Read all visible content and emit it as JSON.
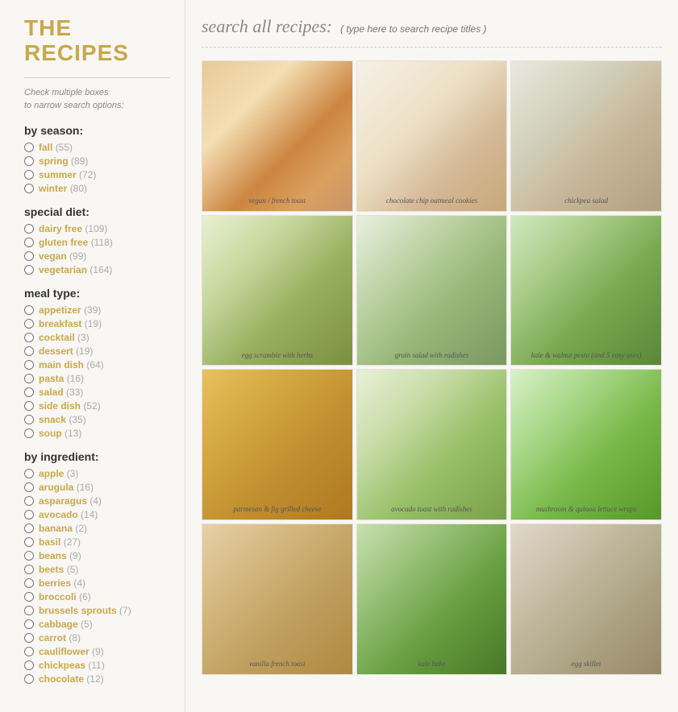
{
  "sidebar": {
    "title": "THE RECIPES",
    "instruction_line1": "Check multiple boxes",
    "instruction_line2": "to narrow search options:",
    "sections": [
      {
        "heading": "by season:",
        "id": "season",
        "items": [
          {
            "name": "fall",
            "count": "55"
          },
          {
            "name": "spring",
            "count": "89"
          },
          {
            "name": "summer",
            "count": "72"
          },
          {
            "name": "winter",
            "count": "80"
          }
        ]
      },
      {
        "heading": "special diet:",
        "id": "diet",
        "items": [
          {
            "name": "dairy free",
            "count": "109"
          },
          {
            "name": "gluten free",
            "count": "118"
          },
          {
            "name": "vegan",
            "count": "99"
          },
          {
            "name": "vegetarian",
            "count": "164"
          }
        ]
      },
      {
        "heading": "meal type:",
        "id": "mealtype",
        "items": [
          {
            "name": "appetizer",
            "count": "39"
          },
          {
            "name": "breakfast",
            "count": "19"
          },
          {
            "name": "cocktail",
            "count": "3"
          },
          {
            "name": "dessert",
            "count": "19"
          },
          {
            "name": "main dish",
            "count": "64"
          },
          {
            "name": "pasta",
            "count": "16"
          },
          {
            "name": "salad",
            "count": "33"
          },
          {
            "name": "side dish",
            "count": "52"
          },
          {
            "name": "snack",
            "count": "35"
          },
          {
            "name": "soup",
            "count": "13"
          }
        ]
      },
      {
        "heading": "by ingredient:",
        "id": "ingredient",
        "items": [
          {
            "name": "apple",
            "count": "3"
          },
          {
            "name": "arugula",
            "count": "16"
          },
          {
            "name": "asparagus",
            "count": "4"
          },
          {
            "name": "avocado",
            "count": "14"
          },
          {
            "name": "banana",
            "count": "2"
          },
          {
            "name": "basil",
            "count": "27"
          },
          {
            "name": "beans",
            "count": "9"
          },
          {
            "name": "beets",
            "count": "5"
          },
          {
            "name": "berries",
            "count": "4"
          },
          {
            "name": "broccoli",
            "count": "6"
          },
          {
            "name": "brussels sprouts",
            "count": "7"
          },
          {
            "name": "cabbage",
            "count": "5"
          },
          {
            "name": "carrot",
            "count": "8"
          },
          {
            "name": "cauliflower",
            "count": "9"
          },
          {
            "name": "chickpeas",
            "count": "11"
          },
          {
            "name": "chocolate",
            "count": "12"
          }
        ]
      }
    ]
  },
  "search": {
    "label": "search all recipes:",
    "placeholder": "( type here to search recipe titles )"
  },
  "recipes": [
    {
      "id": 1,
      "label": "vegan / french toast",
      "css_class": "food-french-toast"
    },
    {
      "id": 2,
      "label": "chocolate chip oatmeal cookies",
      "css_class": "food-cookies"
    },
    {
      "id": 3,
      "label": "chickpea salad",
      "css_class": "food-chickpea-salad"
    },
    {
      "id": 4,
      "label": "egg scramble with herbs",
      "css_class": "food-egg-scramble"
    },
    {
      "id": 5,
      "label": "grain salad with radishes",
      "css_class": "food-grain-salad"
    },
    {
      "id": 6,
      "label": "kale & walnut pesto (and 5 easy uses)",
      "css_class": "food-kale-pesto"
    },
    {
      "id": 7,
      "label": "parmesan & fig grilled cheese",
      "css_class": "food-grilled-cheese"
    },
    {
      "id": 8,
      "label": "avocado toast with radishes",
      "css_class": "food-avocado-toast"
    },
    {
      "id": 9,
      "label": "mushroom & quinoa lettuce wraps",
      "css_class": "food-lettuce-wraps"
    },
    {
      "id": 10,
      "label": "vanilla french toast",
      "css_class": "food-vanilla-french"
    },
    {
      "id": 11,
      "label": "kale bake",
      "css_class": "food-kale-bake"
    },
    {
      "id": 12,
      "label": "egg skillet",
      "css_class": "food-egg-skillet"
    }
  ]
}
